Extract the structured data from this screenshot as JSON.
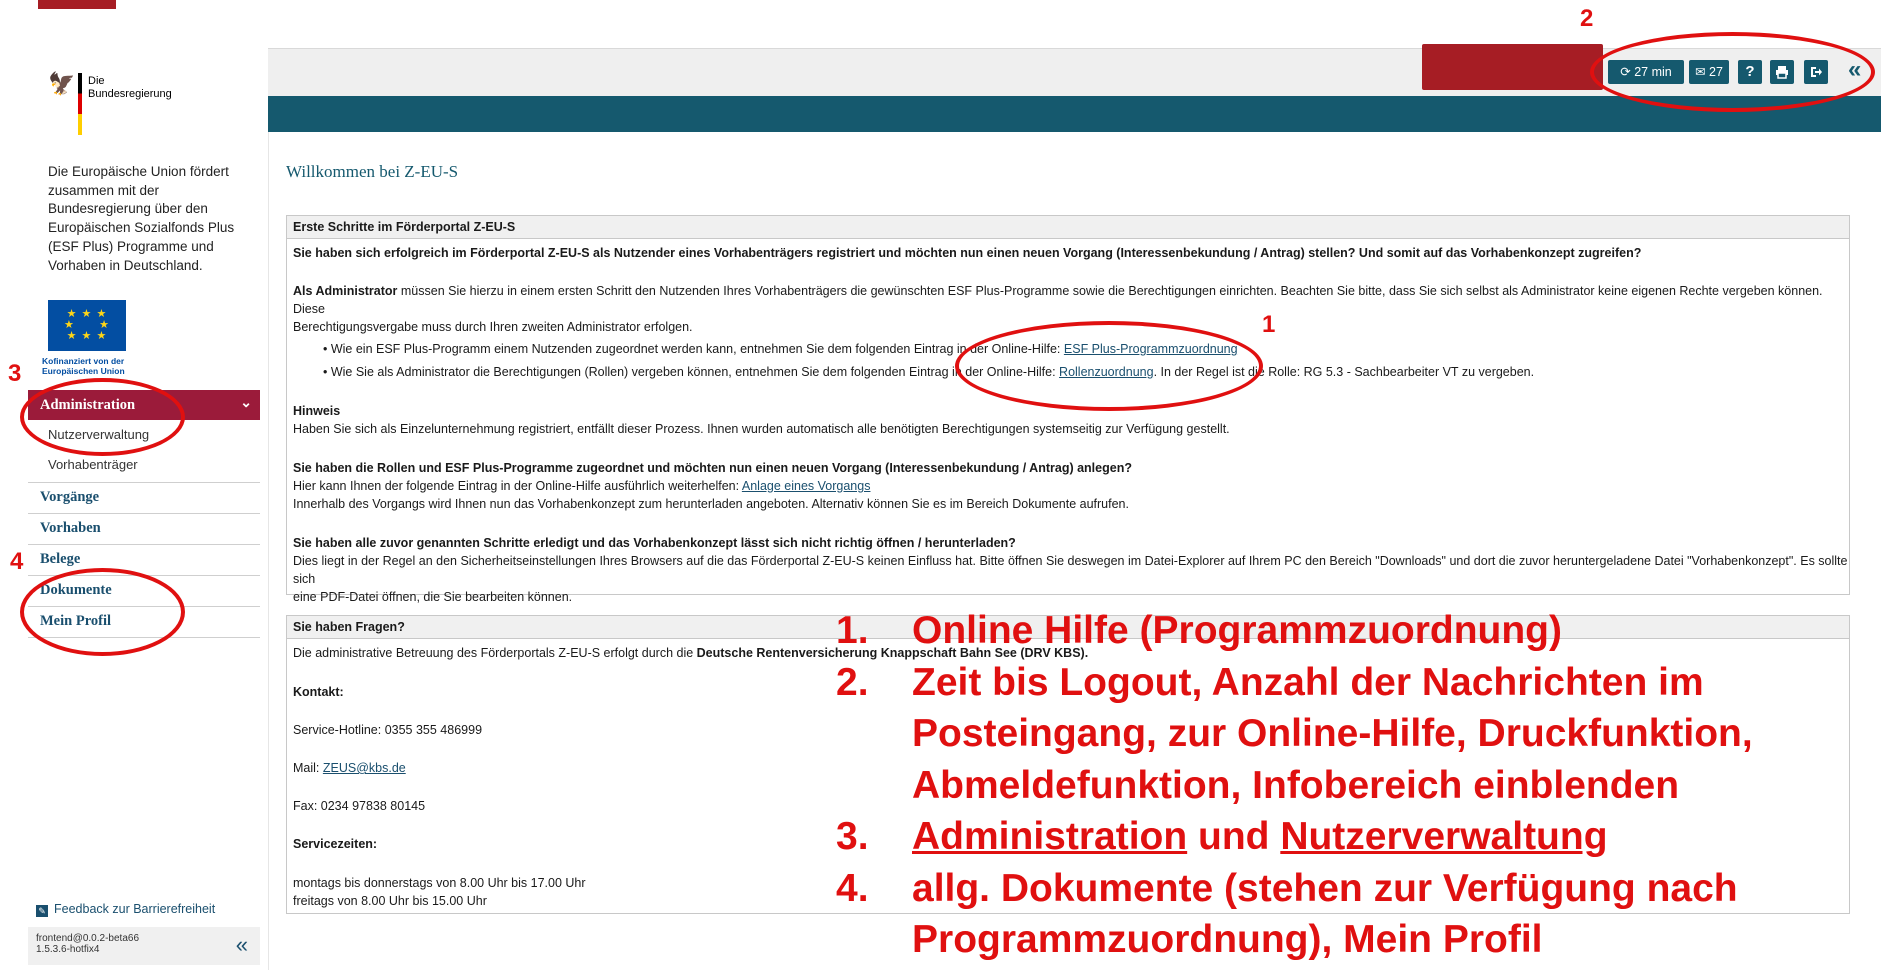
{
  "sidebar": {
    "logo_text_line1": "Die",
    "logo_text_line2": "Bundesregierung",
    "eu_text": "Die Europäische Union fördert zusammen mit der Bundesregierung über den Europäischen Sozialfonds Plus (ESF Plus) Programme und Vorhaben in Deutschland.",
    "eu_cofund_line1": "Kofinanziert von der",
    "eu_cofund_line2": "Europäischen Union",
    "nav": {
      "administration": "Administration",
      "nutzerverwaltung": "Nutzerverwaltung",
      "vorhabentraeger": "Vorhabenträger",
      "vorgaenge": "Vorgänge",
      "vorhaben": "Vorhaben",
      "belege": "Belege",
      "dokumente": "Dokumente",
      "mein_profil": "Mein Profil"
    },
    "feedback": "Feedback zur Barrierefreiheit",
    "version_line1": "frontend@0.0.2-beta66",
    "version_line2": "1.5.3.6-hotfix4"
  },
  "header": {
    "timer": "27 min",
    "messages": "27",
    "help": "?"
  },
  "main": {
    "title": "Willkommen bei Z-EU-S",
    "panel1": {
      "heading": "Erste Schritte im Förderportal Z-EU-S",
      "intro": "Sie haben sich erfolgreich im Förderportal Z-EU-S als Nutzender eines Vorhabenträgers registriert und möchten nun einen neuen Vorgang (Interessenbekundung / Antrag) stellen? Und somit auf das Vorhabenkonzept zugreifen?",
      "admin_bold": "Als Administrator",
      "admin_text_1": " müssen Sie hierzu in einem ersten Schritt den Nutzenden Ihres Vorhabenträgers die gewünschten ESF Plus-Programme sowie die Berechtigungen einrichten. Beachten Sie bitte, dass Sie sich selbst als Administrator keine eigenen Rechte vergeben können. Diese",
      "admin_text_2": "Berechtigungsvergabe muss durch Ihren zweiten Administrator erfolgen.",
      "bullet1_text": "• Wie ein ESF Plus-Programm einem Nutzenden zugeordnet werden kann, entnehmen Sie dem folgenden Eintrag in der Online-Hilfe: ",
      "bullet1_link": "ESF Plus-Programmzuordnung",
      "bullet2_text": "• Wie Sie als Administrator die Berechtigungen (Rollen) vergeben können, entnehmen Sie dem folgenden Eintrag in der Online-Hilfe: ",
      "bullet2_link": "Rollenzuordnung",
      "bullet2_tail": ". In der Regel ist die Rolle: RG 5.3 - Sachbearbeiter VT zu vergeben.",
      "hinweis_head": "Hinweis",
      "hinweis_text": "Haben Sie sich als Einzelunternehmung registriert, entfällt dieser Prozess. Ihnen wurden automatisch alle benötigten Berechtigungen systemseitig zur Verfügung gestellt.",
      "q2_head": "Sie haben die Rollen und ESF Plus-Programme zugeordnet und möchten nun einen neuen Vorgang (Interessenbekundung / Antrag) anlegen?",
      "q2_text": "Hier kann Ihnen der folgende Eintrag in der Online-Hilfe ausführlich weiterhelfen: ",
      "q2_link": "Anlage eines Vorgangs",
      "q2_text2": "Innerhalb des Vorgangs wird Ihnen nun das Vorhabenkonzept zum herunterladen angeboten. Alternativ können Sie es im Bereich Dokumente aufrufen.",
      "q3_head": "Sie haben alle zuvor genannten Schritte erledigt und das Vorhabenkonzept lässt sich nicht richtig öffnen / herunterladen?",
      "q3_text1": "Dies liegt in der Regel an den Sicherheitseinstellungen Ihres Browsers auf die das Förderportal Z-EU-S keinen Einfluss hat. Bitte öffnen Sie deswegen im Datei-Explorer auf Ihrem PC den Bereich \"Downloads\" und dort die zuvor heruntergeladene Datei \"Vorhabenkonzept\". Es sollte sich",
      "q3_text2": "eine PDF-Datei öffnen, die Sie bearbeiten können."
    },
    "panel2": {
      "heading": "Sie haben Fragen?",
      "intro_text": "Die administrative Betreuung des Förderportals Z-EU-S erfolgt durch die ",
      "intro_bold": "Deutsche Rentenversicherung Knappschaft Bahn See (DRV KBS).",
      "kontakt": "Kontakt:",
      "hotline": "Service-Hotline: 0355 355 486999",
      "mail_label": "Mail: ",
      "mail_link": "ZEUS@kbs.de",
      "fax": "Fax: 0234 97838 80145",
      "servicezeiten": "Servicezeiten:",
      "hours1": "montags bis donnerstags von 8.00 Uhr bis 17.00 Uhr",
      "hours2": "freitags von 8.00 Uhr bis 15.00 Uhr"
    }
  },
  "annotations": {
    "num1": "1",
    "num2": "2",
    "num3": "3",
    "num4": "4",
    "legend": {
      "n1": "1.",
      "l1": "Online Hilfe (Programmzuordnung)",
      "n2": "2.",
      "l2a": "Zeit bis Logout, Anzahl der Nachrichten im",
      "l2b": "Posteingang, zur Online-Hilfe, Druckfunktion,",
      "l2c": "Abmeldefunktion, Infobereich einblenden",
      "n3": "3.",
      "l3a": "Administration",
      "l3b": " und ",
      "l3c": "Nutzerverwaltung",
      "n4": "4.",
      "l4a": "allg. Dokumente (stehen zur Verfügung nach",
      "l4b": "Programmzuordnung), Mein Profil"
    },
    "color": "#e01010"
  },
  "colors": {
    "teal": "#15596e",
    "admin_nav": "#9b1b3a",
    "banner_red": "#a61d24"
  },
  "icons": [
    "refresh-icon",
    "envelope-icon",
    "help-icon",
    "print-icon",
    "logout-icon",
    "double-chevron-left-icon",
    "chevron-down-icon",
    "edit-icon",
    "eagle-icon",
    "eu-flag-icon"
  ]
}
